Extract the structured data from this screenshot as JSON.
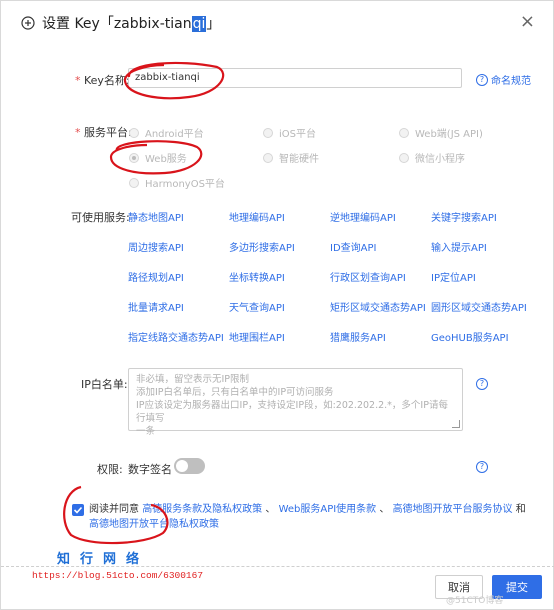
{
  "dialog": {
    "title_prefix": "设置 Key「zabbix-tian",
    "title_highlight": "qi",
    "title_suffix": "」",
    "close": "×"
  },
  "key_name": {
    "label": "Key名称:",
    "required_mark": "*",
    "value": "zabbix-tianqi",
    "help": "命名规范"
  },
  "platform": {
    "label": "服务平台:",
    "required_mark": "*",
    "options": [
      "Android平台",
      "iOS平台",
      "Web端(JS API)",
      "Web服务",
      "智能硬件",
      "微信小程序",
      "HarmonyOS平台"
    ],
    "selected": "Web服务"
  },
  "services": {
    "label": "可使用服务:",
    "items": [
      "静态地图API",
      "地理编码API",
      "逆地理编码API",
      "关键字搜索API",
      "周边搜索API",
      "多边形搜索API",
      "ID查询API",
      "输入提示API",
      "路径规划API",
      "坐标转换API",
      "行政区划查询API",
      "IP定位API",
      "批量请求API",
      "天气查询API",
      "矩形区域交通态势API",
      "圆形区域交通态势API",
      "指定线路交通态势API",
      "地理围栏API",
      "猎鹰服务API",
      "GeoHUB服务API"
    ]
  },
  "ip_whitelist": {
    "label": "IP白名单:",
    "placeholder_lines": [
      "非必填，留空表示无IP限制",
      "添加IP白名单后，只有白名单中的IP可访问服务",
      "IP应该设定为服务器出口IP，支持设定IP段，如:202.202.2.*，多个IP请每行填写",
      "一条"
    ]
  },
  "permission": {
    "label": "权限:",
    "option": "数字签名",
    "enabled": false
  },
  "agreement": {
    "checked": true,
    "prefix": "阅读并同意",
    "link1": "高德服务条款及隐私权政策",
    "sep1": "、",
    "link2": "Web服务API使用条款",
    "sep2": "、",
    "link3": "高德地图开放平台服务协议",
    "sep3": "和",
    "link4": "高德地图开放平台隐私权政策"
  },
  "watermark": {
    "cn": "知行网络",
    "url": "https://blog.51cto.com/6300167",
    "corner": "@51CTO博客"
  },
  "buttons": {
    "cancel": "取消",
    "submit": "提交"
  },
  "colors": {
    "accent": "#2f6ee6",
    "annotation_red": "#d9141b"
  }
}
